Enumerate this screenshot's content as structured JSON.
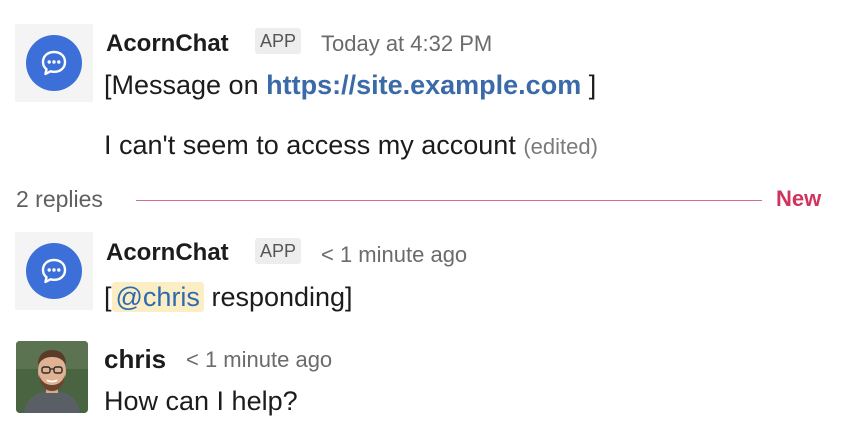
{
  "messages": [
    {
      "sender": "AcornChat",
      "badge": "APP",
      "time": "Today at 4:32 PM",
      "line1_prefix": "[Message on",
      "line1_link": "https://site.example.com",
      "line1_suffix": "]",
      "line2": "I can't seem to access my account",
      "edited": "(edited)"
    }
  ],
  "thread": {
    "replies_label": "2 replies",
    "new_label": "New"
  },
  "replies": [
    {
      "sender": "AcornChat",
      "badge": "APP",
      "time": "< 1 minute ago",
      "prefix": "[",
      "mention": "@chris",
      "suffix": "responding]"
    },
    {
      "sender": "chris",
      "time": "< 1 minute ago",
      "text": "How can I help?"
    }
  ],
  "colors": {
    "bot_avatar": "#3d6fd9",
    "new_divider": "#d6708a",
    "new_label": "#d0345e",
    "link": "#3b6aa8",
    "mention_bg": "#fbeec4"
  },
  "icons": {
    "bot_avatar": "chat-bubble-icon",
    "user_avatar": "user-photo"
  }
}
